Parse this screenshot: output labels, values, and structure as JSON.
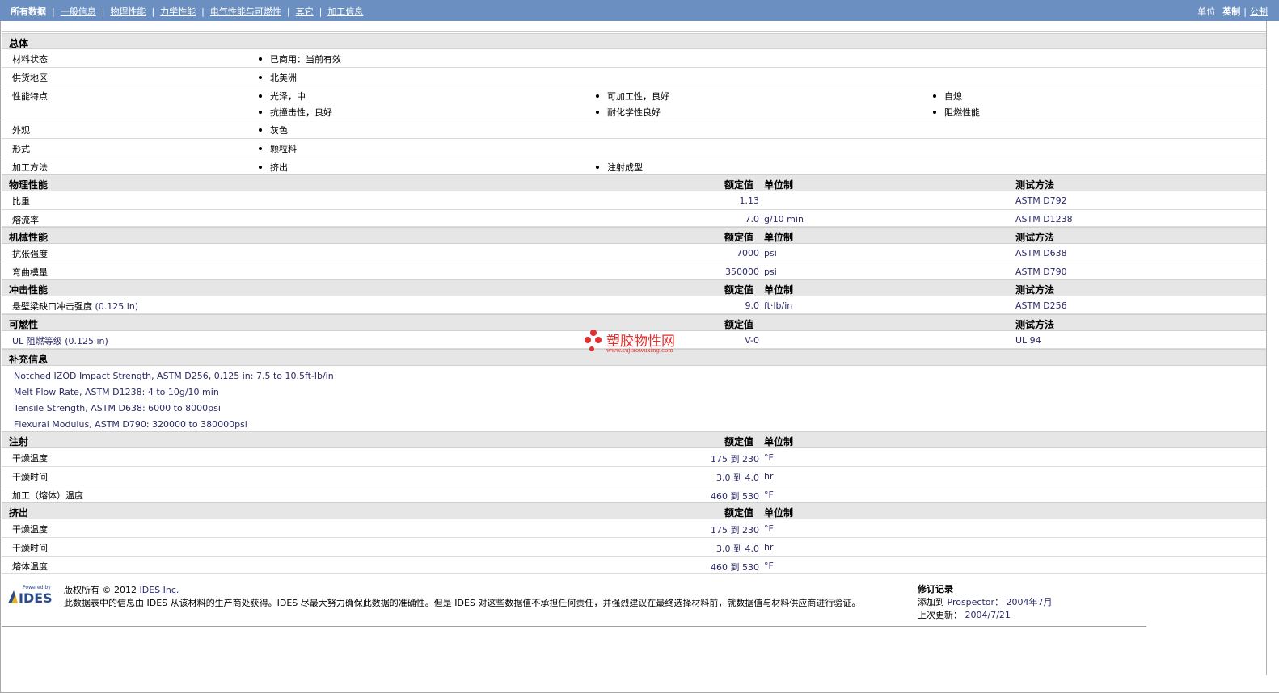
{
  "nav": {
    "items": [
      "所有数据",
      "一般信息",
      "物理性能",
      "力学性能",
      "电气性能与可燃性",
      "其它",
      "加工信息"
    ],
    "unit_label": "单位",
    "unit_english": "英制",
    "unit_metric": "公制",
    "colors": {
      "nav_bg": "#6a8fc0",
      "section_bg": "#e6e6e6",
      "value_text": "#2a2a6a"
    }
  },
  "general": {
    "title": "总体",
    "rows": {
      "status": {
        "label": "材料状态",
        "items": [
          "已商用：当前有效"
        ]
      },
      "region": {
        "label": "供货地区",
        "items": [
          "北美洲"
        ]
      },
      "features": {
        "label": "性能特点",
        "items": [
          "光泽，中",
          "可加工性，良好",
          "自熄",
          "抗撞击性，良好",
          "耐化学性良好",
          "阻燃性能"
        ]
      },
      "appearance": {
        "label": "外观",
        "items": [
          "灰色"
        ]
      },
      "form": {
        "label": "形式",
        "items": [
          "颗粒料"
        ]
      },
      "method": {
        "label": "加工方法",
        "items": [
          "挤出",
          "注射成型"
        ]
      }
    }
  },
  "headers": {
    "nominal": "额定值",
    "unit": "单位制",
    "test": "测试方法"
  },
  "physical": {
    "title": "物理性能",
    "rows": [
      {
        "label": "比重",
        "value": "1.13",
        "unit": "",
        "test": "ASTM D792"
      },
      {
        "label": "熔流率",
        "value": "7.0",
        "unit": "g/10 min",
        "test": "ASTM D1238"
      }
    ]
  },
  "mechanical": {
    "title": "机械性能",
    "rows": [
      {
        "label": "抗张强度",
        "value": "7000",
        "unit": "psi",
        "test": "ASTM D638"
      },
      {
        "label": "弯曲模量",
        "value": "350000",
        "unit": "psi",
        "test": "ASTM D790"
      }
    ]
  },
  "impact": {
    "title": "冲击性能",
    "rows": [
      {
        "label": "悬壁梁缺口冲击强度",
        "cond": "(0.125 in)",
        "value": "9.0",
        "unit": "ft·lb/in",
        "test": "ASTM D256"
      }
    ]
  },
  "flammability": {
    "title": "可燃性",
    "rows": [
      {
        "label": "UL 阻燃等级",
        "cond": "(0.125 in)",
        "value": "V-0",
        "unit": "",
        "test": "UL 94"
      }
    ]
  },
  "supplemental": {
    "title": "补充信息",
    "lines": [
      "Notched IZOD Impact Strength, ASTM D256, 0.125 in: 7.5 to 10.5ft-lb/in",
      "Melt Flow Rate, ASTM D1238: 4 to 10g/10 min",
      "Tensile Strength, ASTM D638: 6000 to 8000psi",
      "Flexural Modulus, ASTM D790: 320000 to 380000psi"
    ]
  },
  "injection": {
    "title": "注射",
    "rows": [
      {
        "label": "干燥温度",
        "value": "175 到  230",
        "unit": "°F"
      },
      {
        "label": "干燥时间",
        "value": "3.0 到  4.0",
        "unit": "hr"
      },
      {
        "label": "加工（熔体）温度",
        "value": "460 到  530",
        "unit": "°F"
      }
    ]
  },
  "extrusion": {
    "title": "挤出",
    "rows": [
      {
        "label": "干燥温度",
        "value": "175 到  230",
        "unit": "°F"
      },
      {
        "label": "干燥时间",
        "value": "3.0 到  4.0",
        "unit": "hr"
      },
      {
        "label": "熔体温度",
        "value": "460 到  530",
        "unit": "°F"
      }
    ]
  },
  "footer": {
    "logo_small": "Powered by",
    "logo_big": "IDES",
    "copyright_prefix": "版权所有 © 2012",
    "copyright_link": "IDES Inc.",
    "disclaimer": "此数据表中的信息由  IDES 从该材料的生产商处获得。IDES 尽最大努力确保此数据的准确性。但是  IDES 对这些数据值不承担任何责任，并强烈建议在最终选择材料前，就数据值与材料供应商进行验证。",
    "revision_title": "修订记录",
    "added_label": "添加到",
    "added_source": "Prospector：",
    "added_date": "2004年7月",
    "updated_label": "上次更新：",
    "updated_date": "2004/7/21"
  },
  "watermark": {
    "text": "塑胶物性网",
    "url": "www.sujiaowuxing.com"
  }
}
